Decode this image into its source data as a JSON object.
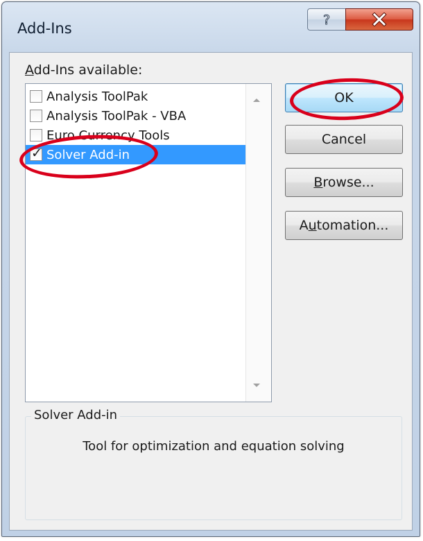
{
  "window": {
    "title": "Add-Ins",
    "help_glyph": "?",
    "close_glyph": "X"
  },
  "list": {
    "label_accel": "A",
    "label_rest": "dd-Ins available:",
    "items": [
      {
        "label": "Analysis ToolPak",
        "checked": false,
        "selected": false
      },
      {
        "label": "Analysis ToolPak - VBA",
        "checked": false,
        "selected": false
      },
      {
        "label": "Euro Currency Tools",
        "checked": false,
        "selected": false
      },
      {
        "label": "Solver Add-in",
        "checked": true,
        "selected": true
      }
    ],
    "check_glyph": "✓"
  },
  "buttons": {
    "ok": "OK",
    "cancel": "Cancel",
    "browse_accel": "B",
    "browse_rest": "rowse...",
    "automation_pre": "A",
    "automation_accel": "u",
    "automation_rest": "tomation..."
  },
  "description": {
    "group_label": "Solver Add-in",
    "text": "Tool for optimization and equation solving"
  },
  "annotations": {
    "color": "#d9001b"
  }
}
